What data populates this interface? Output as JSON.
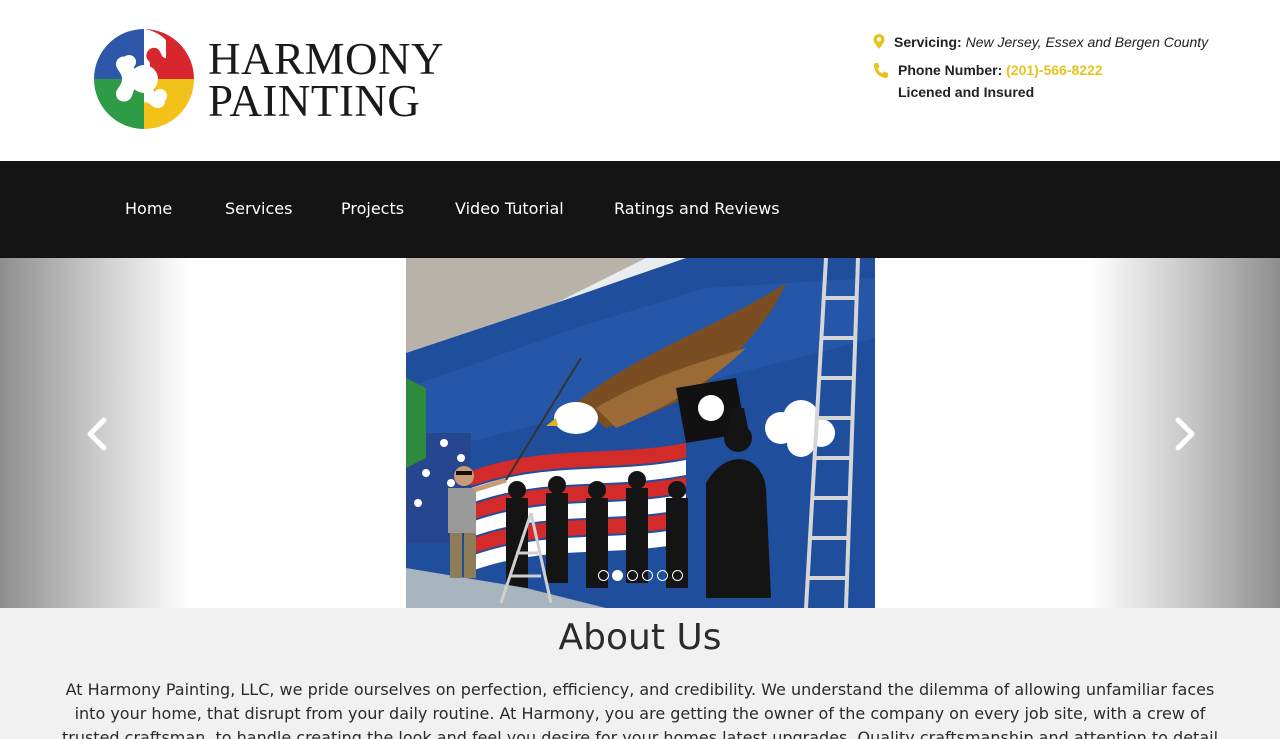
{
  "header": {
    "logo_line1": "HARMONY",
    "logo_line2": "PAINTING",
    "servicing_label": "Servicing:",
    "servicing_value": "New Jersey, Essex and Bergen County",
    "phone_label": "Phone Number:",
    "phone_value": "(201)-566-8222",
    "licensed_text": "Licened and Insured",
    "icons": {
      "location": "map-pin-icon",
      "phone": "phone-icon"
    },
    "colors": {
      "accent": "#e8c21f",
      "logo_blue": "#2d57a8",
      "logo_red": "#d8262e",
      "logo_yellow": "#f3c21a",
      "logo_green": "#2e9b46"
    }
  },
  "nav": {
    "items": [
      {
        "label": "Home"
      },
      {
        "label": "Services"
      },
      {
        "label": "Projects"
      },
      {
        "label": "Video Tutorial"
      },
      {
        "label": "Ratings and Reviews"
      }
    ],
    "background": "#141414"
  },
  "slider": {
    "prev_icon": "chevron-left-icon",
    "next_icon": "chevron-right-icon",
    "slide_count": 6,
    "active_slide": 1
  },
  "about": {
    "heading": "About Us",
    "body": "At Harmony Painting, LLC, we pride ourselves on perfection, efficiency, and credibility. We understand the dilemma of allowing unfamiliar faces into your home, that disrupt from your daily routine. At Harmony, you are getting the owner of the company on every job site, with a crew of trusted craftsman, to handle creating the look and feel you desire for your homes latest upgrades. Quality craftsmanship and attention to detail is our priority."
  }
}
